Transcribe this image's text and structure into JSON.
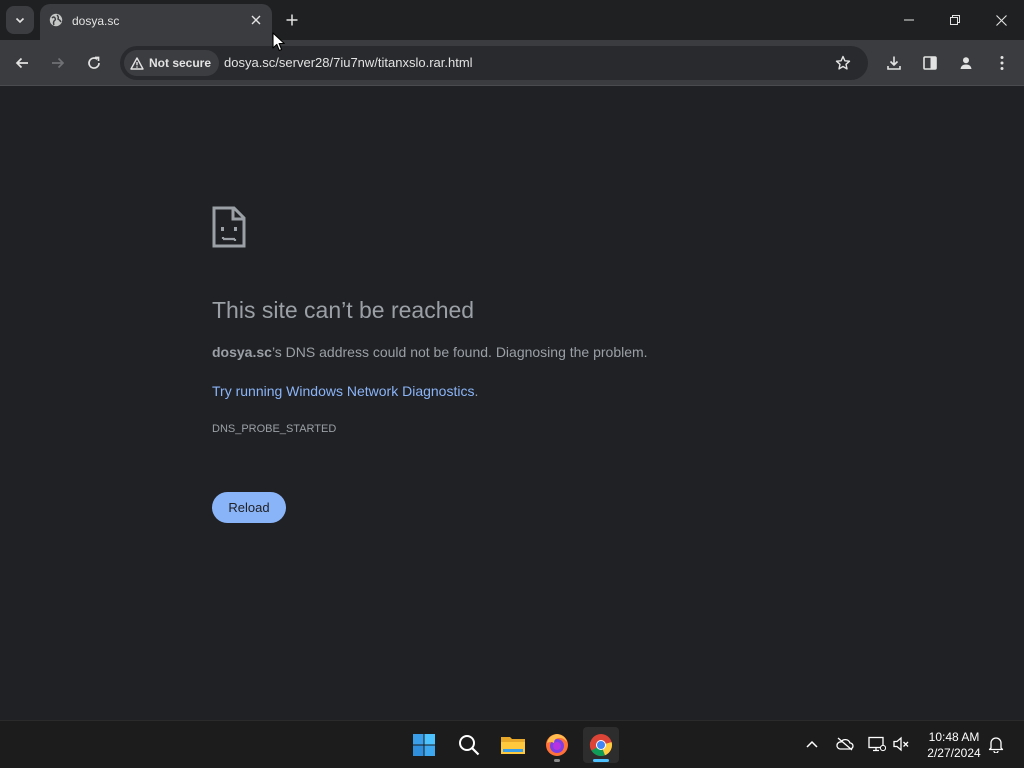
{
  "browser": {
    "tab": {
      "title": "dosya.sc",
      "favicon": "globe-icon"
    },
    "toolbar": {
      "security_chip": "Not secure",
      "url": "dosya.sc/server28/7iu7nw/titanxslo.rar.html"
    }
  },
  "error_page": {
    "title": "This site can’t be reached",
    "host": "dosya.sc",
    "description": "’s DNS address could not be found. Diagnosing the problem.",
    "suggestion_link": "Try running Windows Network Diagnostics",
    "suggestion_suffix": ".",
    "error_code": "DNS_PROBE_STARTED",
    "reload_label": "Reload"
  },
  "taskbar": {
    "apps": [
      "start-icon",
      "search-icon",
      "file-explorer-icon",
      "firefox-icon",
      "chrome-icon"
    ],
    "clock": {
      "time": "10:48 AM",
      "date": "2/27/2024"
    }
  },
  "colors": {
    "page_bg": "#202124",
    "link": "#8ab4f8",
    "button": "#8ab4f8",
    "text": "#9aa0a6"
  }
}
